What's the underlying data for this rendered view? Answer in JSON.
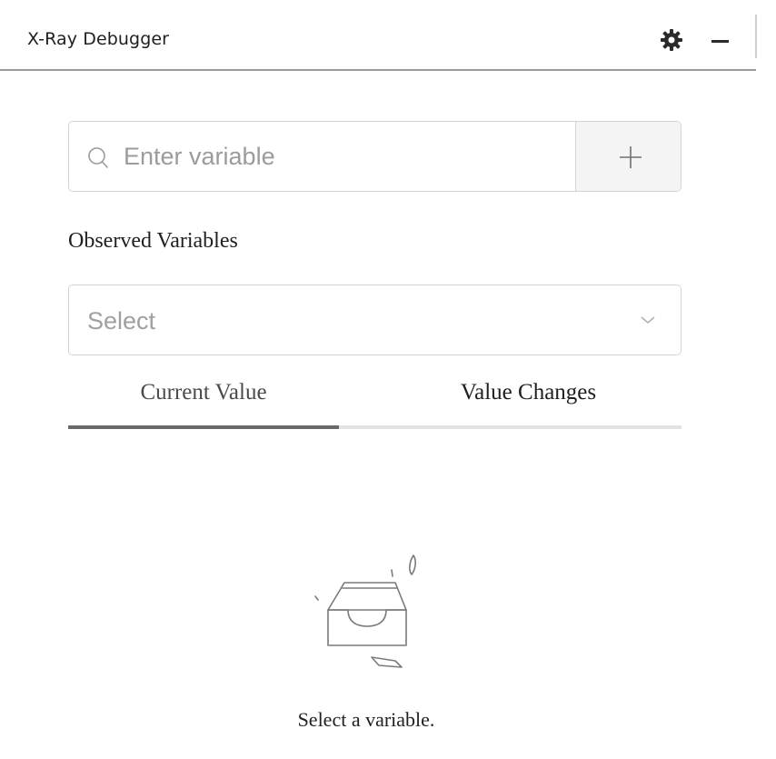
{
  "window": {
    "title": "X-Ray Debugger",
    "icons": [
      "gear-icon",
      "minimize-icon"
    ]
  },
  "search": {
    "placeholder": "Enter variable",
    "value": "",
    "add_icon": "plus-icon"
  },
  "observed": {
    "label": "Observed Variables",
    "select_placeholder": "Select"
  },
  "tabs": [
    {
      "label": "Current Value",
      "active": true
    },
    {
      "label": "Value Changes",
      "active": false
    }
  ],
  "empty_state": {
    "icon": "empty-inbox-icon",
    "message": "Select a variable."
  },
  "colors": {
    "indicator": "#6a6a6a",
    "track": "#e2e2e2",
    "border": "#d4d4d4",
    "add_button_bg": "#f4f4f4"
  }
}
